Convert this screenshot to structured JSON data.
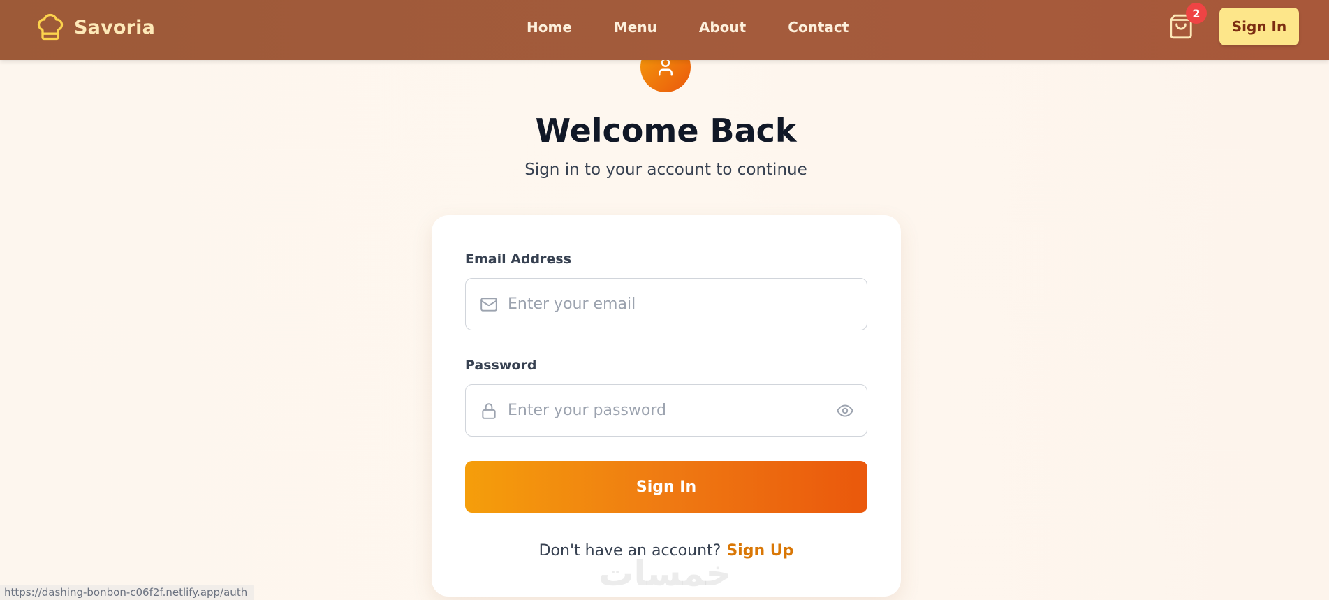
{
  "navbar": {
    "brand_name": "Savoria",
    "links": [
      "Home",
      "Menu",
      "About",
      "Contact"
    ],
    "cart_count": "2",
    "signin_label": "Sign In"
  },
  "hero": {
    "title": "Welcome Back",
    "subtitle": "Sign in to your account to continue"
  },
  "form": {
    "email_label": "Email Address",
    "email_placeholder": "Enter your email",
    "password_label": "Password",
    "password_placeholder": "Enter your password",
    "submit_label": "Sign In",
    "signup_prompt": "Don't have an account?",
    "signup_link": "Sign Up"
  },
  "watermark": "خمسات",
  "status_url": "https://dashing-bonbon-c06f2f.netlify.app/auth",
  "icons": {
    "brand": "chef-hat-icon",
    "cart": "shopping-bag-icon",
    "avatar": "user-icon",
    "email": "mail-icon",
    "password": "lock-icon",
    "toggle": "eye-icon"
  },
  "colors": {
    "navbar": "#a45b3c",
    "brand_text": "#fde9b8",
    "signin_button": "#fde68a",
    "primary_gradient_start": "#f59e0b",
    "primary_gradient_end": "#ea580c",
    "badge": "#ef4444",
    "link": "#d97706"
  }
}
